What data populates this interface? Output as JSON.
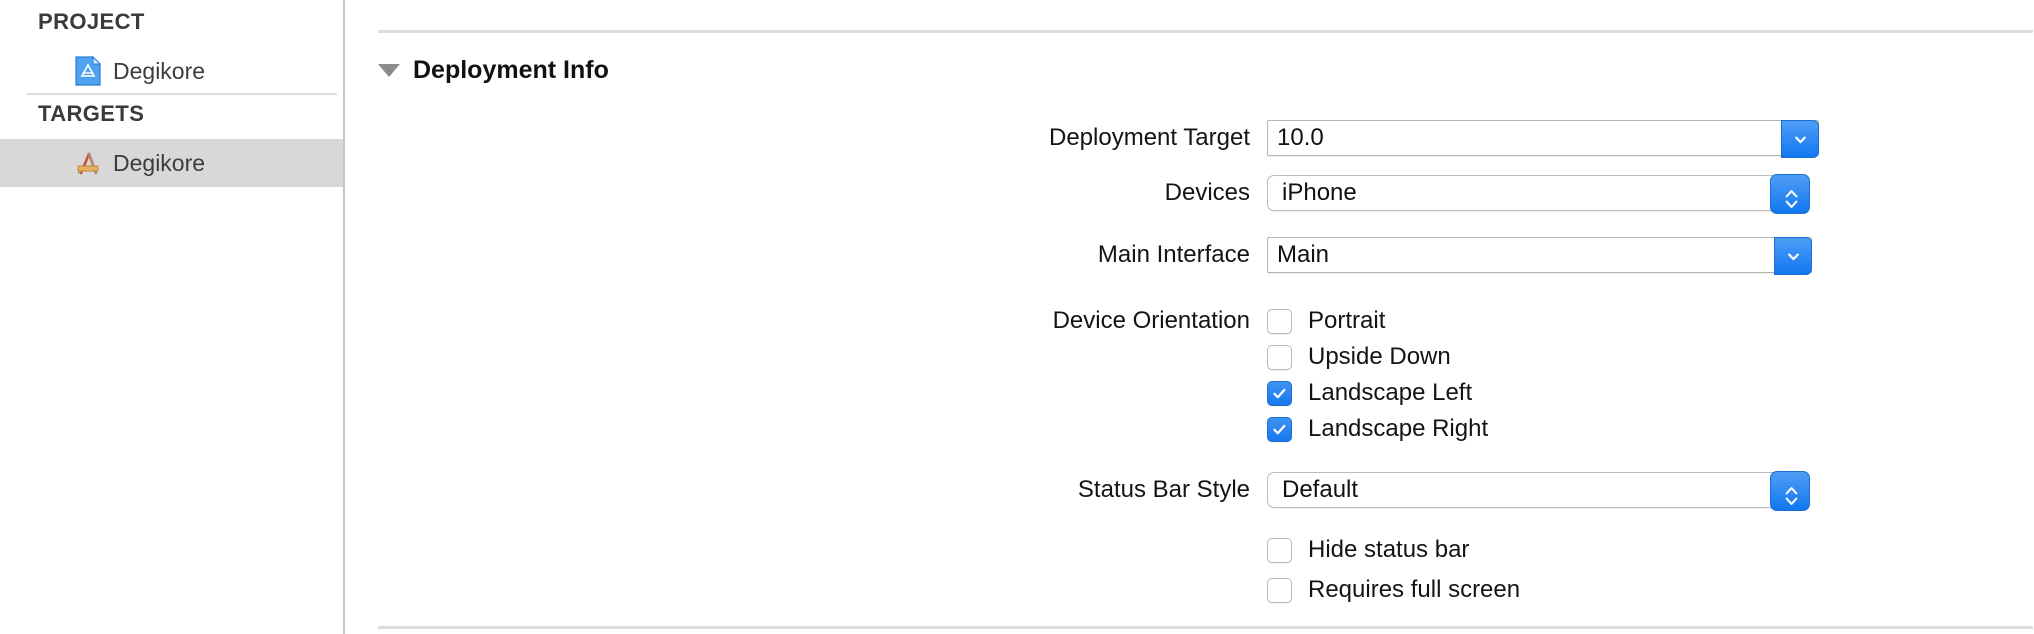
{
  "sidebar": {
    "groups": [
      {
        "header": "PROJECT",
        "items": [
          {
            "label": "Degikore",
            "icon": "xcode-project-document-icon",
            "selected": false
          }
        ]
      },
      {
        "header": "TARGETS",
        "items": [
          {
            "label": "Degikore",
            "icon": "xcode-target-app-icon",
            "selected": true
          }
        ]
      }
    ]
  },
  "main": {
    "section": {
      "title": "Deployment Info",
      "disclosure_icon": "triangle-down-icon",
      "expanded": true
    },
    "fields": {
      "deployment_target": {
        "label": "Deployment Target",
        "value": "10.0",
        "control": "combo-box",
        "button_icon": "chevron-down-icon"
      },
      "devices": {
        "label": "Devices",
        "value": "iPhone",
        "control": "popup-button",
        "button_icon": "chevron-up-down-icon"
      },
      "main_interface": {
        "label": "Main Interface",
        "value": "Main",
        "control": "combo-box",
        "button_icon": "chevron-down-icon"
      },
      "status_bar_style": {
        "label": "Default",
        "title": "Status Bar Style",
        "value": "Default",
        "control": "popup-button",
        "button_icon": "chevron-up-down-icon"
      }
    },
    "device_orientation": {
      "label": "Device Orientation",
      "options": [
        {
          "label": "Portrait",
          "checked": false
        },
        {
          "label": "Upside Down",
          "checked": false
        },
        {
          "label": "Landscape Left",
          "checked": true
        },
        {
          "label": "Landscape Right",
          "checked": true
        }
      ]
    },
    "status_bar_options": [
      {
        "label": "Hide status bar",
        "checked": false
      },
      {
        "label": "Requires full screen",
        "checked": false
      }
    ]
  },
  "colors": {
    "accent_blue": "#1877ee",
    "selection_gray": "#d8d8d8",
    "divider_gray": "#dcdcdc",
    "border_gray": "#b4b4b4"
  }
}
